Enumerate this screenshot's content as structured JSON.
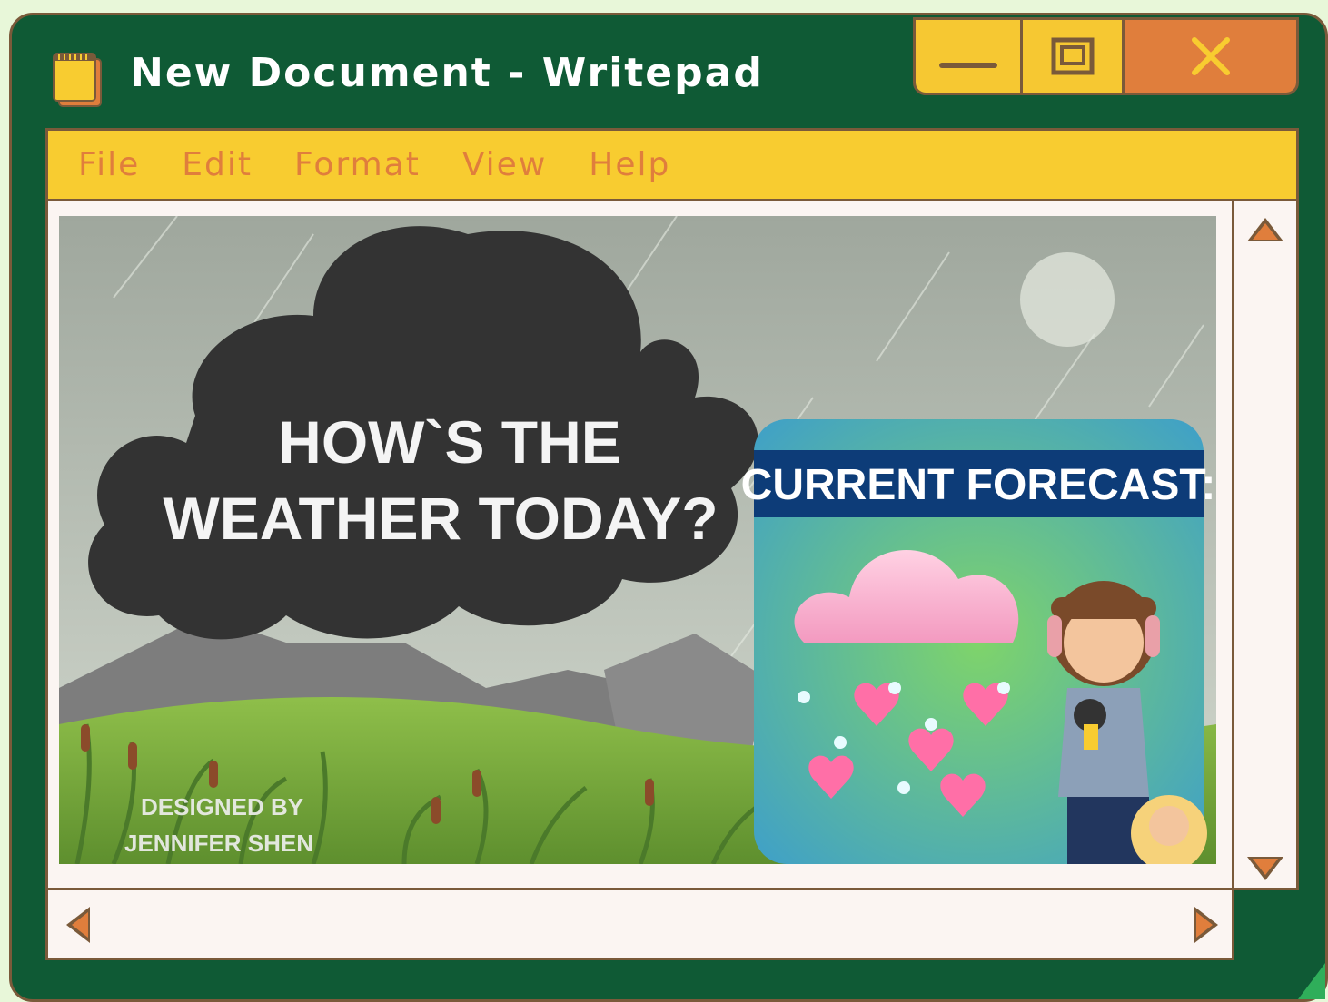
{
  "window": {
    "title": "New Document - Writepad",
    "app_icon": "notepad-icon",
    "controls": {
      "minimize_icon": "minimize-icon",
      "maximize_icon": "maximize-icon",
      "close_icon": "close-icon"
    }
  },
  "menu": {
    "items": [
      {
        "label": "File"
      },
      {
        "label": "Edit"
      },
      {
        "label": "Format"
      },
      {
        "label": "View"
      },
      {
        "label": "Help"
      }
    ]
  },
  "document_image": {
    "heading_line1": "HOW`S THE",
    "heading_line2": "WEATHER TODAY?",
    "forecast_label": "CURRENT  FORECAST:",
    "credit_line1": "DESIGNED BY",
    "credit_line2": "JENNIFER SHEN"
  },
  "scrollbars": {
    "up_icon": "arrow-up-icon",
    "down_icon": "arrow-down-icon",
    "left_icon": "arrow-left-icon",
    "right_icon": "arrow-right-icon"
  },
  "colors": {
    "window_bg": "#0f5a35",
    "menubar": "#f8cc30",
    "accent_orange": "#e07e3c",
    "border": "#7a5a3a",
    "page_bg": "#e8f7d9"
  }
}
